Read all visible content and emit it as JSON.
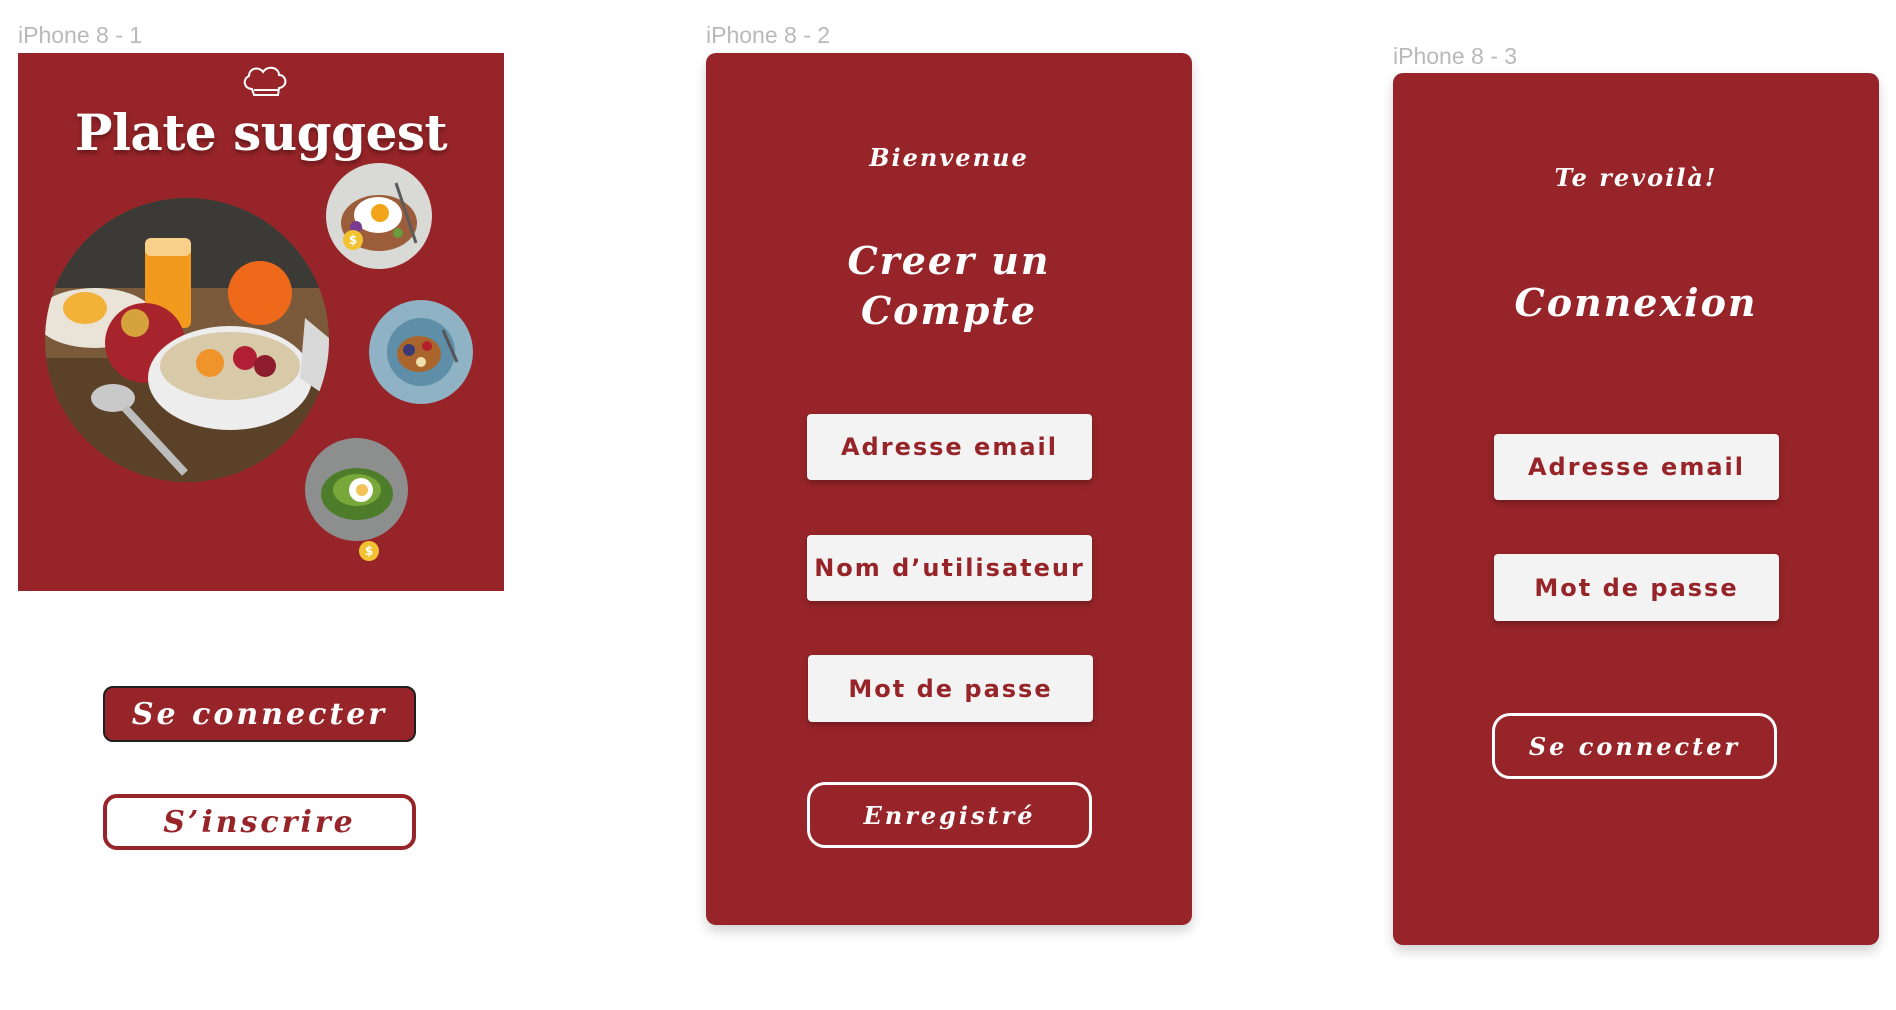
{
  "artboards": [
    {
      "label": "iPhone 8 - 1"
    },
    {
      "label": "iPhone 8 - 2"
    },
    {
      "label": "iPhone 8 - 3"
    }
  ],
  "screen1": {
    "title": "Plate suggest",
    "login_button": "Se connecter",
    "signup_button": "S’inscrire",
    "coin_symbol": "$",
    "icon": "chef-hat-icon",
    "brand_color": "#962428"
  },
  "screen2": {
    "welcome": "Bienvenue",
    "heading_line1": "Creer un",
    "heading_line2": "Compte",
    "email_field": "Adresse email",
    "username_field": "Nom d’utilisateur",
    "password_field": "Mot de passe",
    "submit_button": "Enregistré"
  },
  "screen3": {
    "welcome": "Te revoilà!",
    "heading": "Connexion",
    "email_field": "Adresse email",
    "password_field": "Mot de passe",
    "submit_button": "Se connecter"
  }
}
